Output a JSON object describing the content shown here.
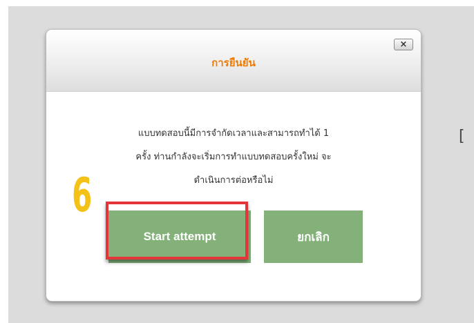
{
  "dialog": {
    "title": "การยืนยัน",
    "close_label": "×",
    "message_lines": [
      "แบบทดสอบนี้มีการจำกัดเวลาและสามารถทำได้ 1",
      "ครั้ง ท่านกำลังจะเริ่มการทำแบบทดสอบครั้งใหม่ จะ",
      "ดำเนินการต่อหรือไม่"
    ],
    "start_button_label": "Start attempt",
    "cancel_button_label": "ยกเลิก"
  },
  "annotation": {
    "step_number": "6"
  },
  "background_glyph": "[",
  "colors": {
    "title": "#ef7a00",
    "button": "#84b17a",
    "highlight_border": "#e3353a",
    "step_number": "#f3c117"
  }
}
